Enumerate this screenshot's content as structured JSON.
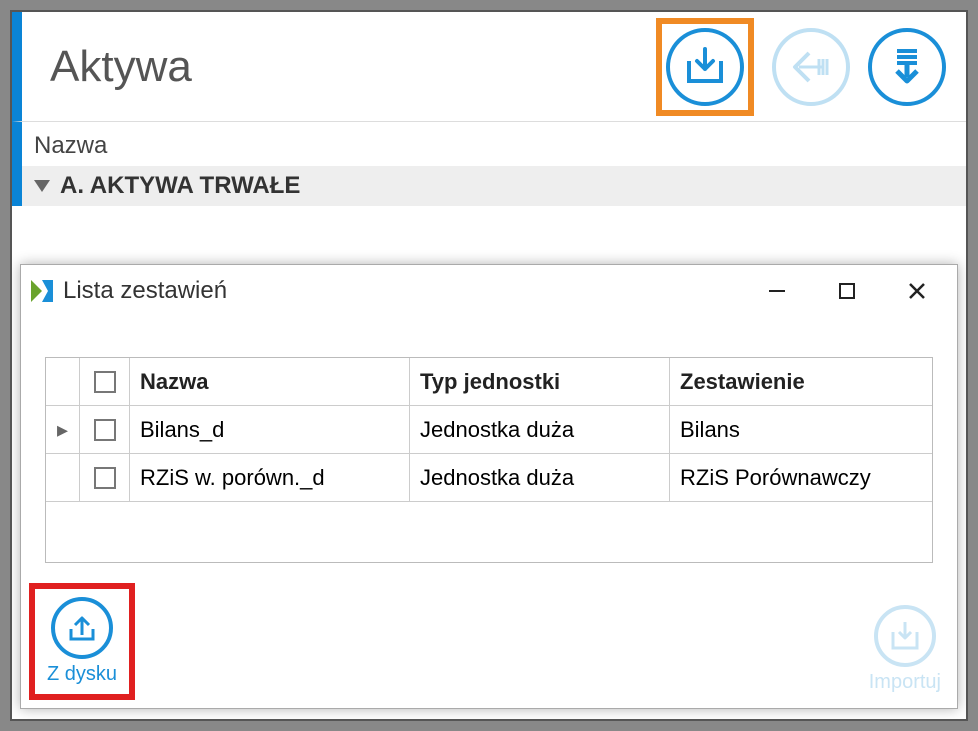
{
  "main": {
    "title": "Aktywa",
    "column_label": "Nazwa",
    "group_row": "A. AKTYWA TRWAŁE"
  },
  "dialog": {
    "title": "Lista zestawień",
    "columns": {
      "name": "Nazwa",
      "type": "Typ jednostki",
      "set": "Zestawienie"
    },
    "rows": [
      {
        "name": "Bilans_d",
        "type": "Jednostka duża",
        "set": "Bilans"
      },
      {
        "name": "RZiS w. porówn._d",
        "type": "Jednostka duża",
        "set": "RZiS Porównawczy"
      }
    ],
    "footer": {
      "from_disk": "Z dysku",
      "import": "Importuj"
    }
  }
}
